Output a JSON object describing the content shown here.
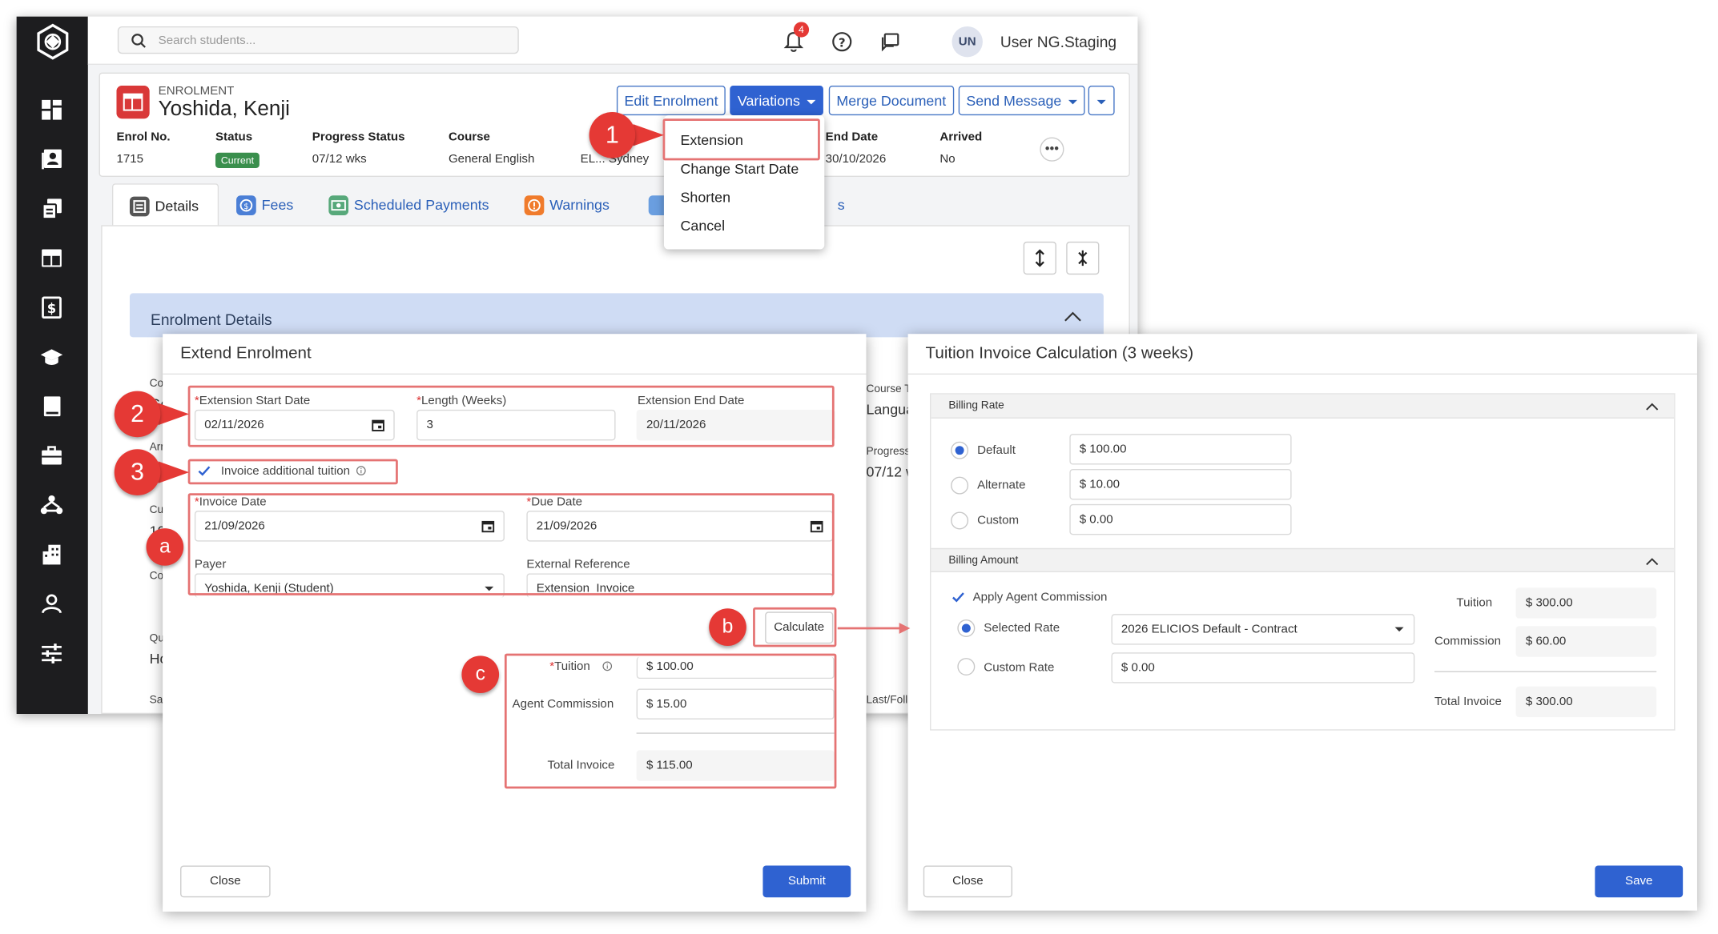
{
  "topbar": {
    "search_placeholder": "Search students...",
    "notification_count": "4",
    "avatar_initials": "UN",
    "user_name": "User NG.Staging"
  },
  "enrolment": {
    "label": "ENROLMENT",
    "name": "Yoshida, Kenji",
    "buttons": {
      "edit": "Edit Enrolment",
      "variations": "Variations",
      "merge": "Merge Document",
      "send": "Send Message"
    },
    "fields": [
      {
        "label": "Enrol No.",
        "value": "1715"
      },
      {
        "label": "Status",
        "value": "Current"
      },
      {
        "label": "Progress Status",
        "value": "07/12 wks"
      },
      {
        "label": "Course",
        "value": "General English"
      },
      {
        "label": "",
        "value": "EL... Sydney"
      },
      {
        "label": "End Date",
        "value": "30/10/2026"
      },
      {
        "label": "Arrived",
        "value": "No"
      }
    ],
    "more": "•••"
  },
  "variations_menu": [
    "Extension",
    "Change Start Date",
    "Shorten",
    "Cancel"
  ],
  "tabs": [
    "Details",
    "Fees",
    "Scheduled Payments",
    "Warnings",
    "s"
  ],
  "details": {
    "section_title": "Enrolment Details",
    "bg_left": [
      "Co",
      "Ge",
      "Arr",
      "Mo",
      "Cu",
      "10",
      "Co",
      "Qu",
      "Ho",
      "Sal"
    ],
    "bg_right": [
      "Course T",
      "Langua",
      "Progress",
      "07/12 w",
      "Last/Foll"
    ]
  },
  "extend_modal": {
    "title": "Extend Enrolment",
    "ext_start_label": "Extension Start Date",
    "ext_start_value": "02/11/2026",
    "length_label": "Length (Weeks)",
    "length_value": "3",
    "ext_end_label": "Extension End Date",
    "ext_end_value": "20/11/2026",
    "invoice_check_label": "Invoice additional tuition",
    "invoice_date_label": "Invoice Date",
    "invoice_date_value": "21/09/2026",
    "due_date_label": "Due Date",
    "due_date_value": "21/09/2026",
    "payer_label": "Payer",
    "payer_value": "Yoshida, Kenji (Student)",
    "ext_ref_label": "External Reference",
    "ext_ref_value": "Extension_Invoice",
    "calculate": "Calculate",
    "tuition_label": "Tuition",
    "tuition_value": "$ 100.00",
    "commission_label": "Agent Commission",
    "commission_value": "$ 15.00",
    "total_label": "Total Invoice",
    "total_value": "$ 115.00",
    "close": "Close",
    "submit": "Submit"
  },
  "tuition_modal": {
    "title": "Tuition Invoice Calculation (3 weeks)",
    "billing_rate_header": "Billing Rate",
    "rates": [
      {
        "label": "Default",
        "value": "$ 100.00",
        "selected": true
      },
      {
        "label": "Alternate",
        "value": "$ 10.00",
        "selected": false
      },
      {
        "label": "Custom",
        "value": "$ 0.00",
        "selected": false
      }
    ],
    "billing_amount_header": "Billing Amount",
    "apply_commission_label": "Apply Agent Commission",
    "selected_rate_label": "Selected Rate",
    "selected_rate_value": "2026 ELICIOS Default - Contract",
    "custom_rate_label": "Custom Rate",
    "custom_rate_value": "$ 0.00",
    "tuition_label": "Tuition",
    "tuition_value": "$ 300.00",
    "commission_label": "Commission",
    "commission_value": "$ 60.00",
    "total_label": "Total Invoice",
    "total_value": "$ 300.00",
    "close": "Close",
    "save": "Save"
  },
  "callouts": [
    "1",
    "2",
    "3",
    "a",
    "b",
    "c"
  ],
  "colors": {
    "accent": "#2f62d1",
    "callout": "#e53935",
    "highlight": "#e57373",
    "sidebar": "#1d1d1f"
  }
}
